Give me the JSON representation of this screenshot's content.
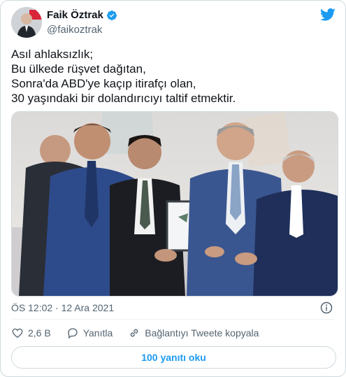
{
  "author": {
    "display_name": "Faik Öztrak",
    "handle": "@faikoztrak",
    "verified": true,
    "avatar_icon": "profile-photo"
  },
  "tweet": {
    "lines": [
      "Asıl ahlaksızlık;",
      "Bu ülkede rüşvet dağıtan,",
      "Sonra'da ABD'ye kaçıp itirafçı olan,",
      "30 yaşındaki bir dolandırıcıyı taltif etmektir."
    ],
    "media_alt": "photo-award-ceremony"
  },
  "meta": {
    "time": "ÖS 12:02",
    "separator": "·",
    "date": "12 Ara 2021"
  },
  "actions": {
    "like_count": "2,6 B",
    "reply_label": "Yanıtla",
    "copy_link_label": "Bağlantıyı Tweete kopyala"
  },
  "read_replies_label": "100 yanıtı oku",
  "colors": {
    "brand_blue": "#1d9bf0",
    "text_primary": "#0f1419",
    "text_secondary": "#536471",
    "border": "#cfd9de"
  }
}
